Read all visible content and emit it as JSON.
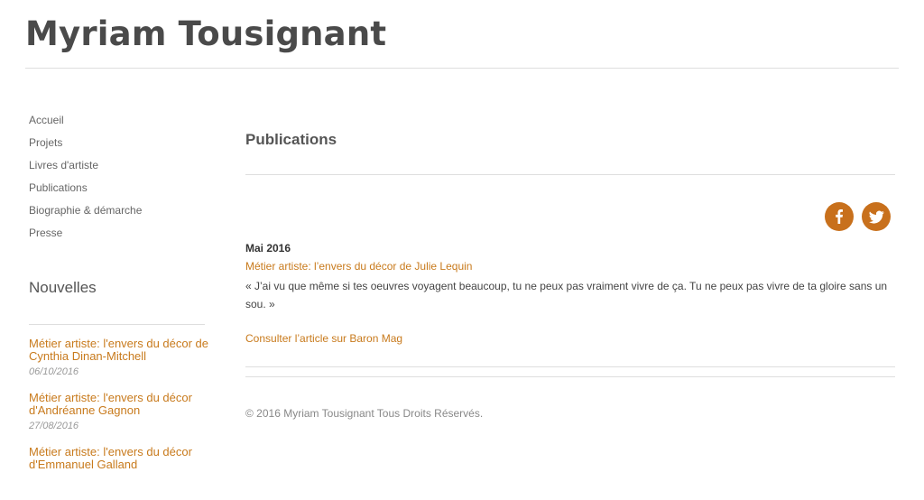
{
  "site": {
    "title": "Myriam Tousignant"
  },
  "nav": {
    "items": [
      {
        "label": "Accueil"
      },
      {
        "label": "Projets"
      },
      {
        "label": "Livres d'artiste"
      },
      {
        "label": "Publications"
      },
      {
        "label": "Biographie & démarche"
      },
      {
        "label": "Presse"
      }
    ]
  },
  "news": {
    "heading": "Nouvelles",
    "items": [
      {
        "title": "Métier artiste: l'envers du décor de Cynthia Dinan-Mitchell",
        "date": "06/10/2016"
      },
      {
        "title": "Métier artiste: l'envers du décor d'Andréanne Gagnon",
        "date": "27/08/2016"
      },
      {
        "title": "Métier artiste: l'envers du décor d'Emmanuel Galland",
        "date": ""
      }
    ]
  },
  "main": {
    "page_title": "Publications",
    "social": {
      "icons": [
        "facebook-icon",
        "twitter-icon"
      ],
      "color": "#c8701c"
    },
    "publication": {
      "date": "Mai 2016",
      "link": "Métier artiste: l’envers du décor de Julie Lequin",
      "quote": "« J’ai vu que même si tes oeuvres voyagent beaucoup, tu ne peux pas vraiment vivre de ça. Tu ne peux pas vivre de ta gloire sans un sou. »",
      "article_link": "Consulter l’article sur Baron Mag"
    }
  },
  "footer": {
    "copyright": "© 2016 Myriam Tousignant Tous Droits Réservés."
  }
}
